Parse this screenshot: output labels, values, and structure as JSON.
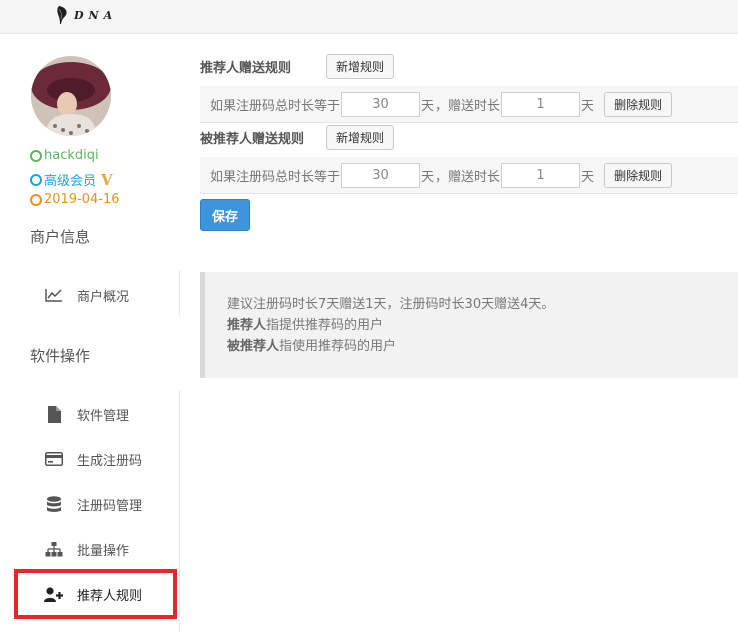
{
  "brand": {
    "logo_text": "DNA"
  },
  "user": {
    "username": "hackdiqi",
    "member_level": "高级会员",
    "vip_badge": "V",
    "join_date": "2019-04-16",
    "colors": {
      "username": "#5cb85c",
      "member_level": "#1fa3e0",
      "join_date": "#f0901e",
      "vip_badge": "#f3a53b"
    }
  },
  "sidebar": {
    "merchant_section": "商户信息",
    "merchant_items": [
      {
        "label": "商户概况",
        "icon": "line-chart-icon"
      }
    ],
    "software_section": "软件操作",
    "software_items": [
      {
        "label": "软件管理",
        "icon": "file-icon"
      },
      {
        "label": "生成注册码",
        "icon": "credit-card-icon"
      },
      {
        "label": "注册码管理",
        "icon": "database-icon"
      },
      {
        "label": "批量操作",
        "icon": "sitemap-icon"
      },
      {
        "label": "推荐人规则",
        "icon": "user-plus-icon",
        "active": true
      }
    ],
    "active_highlight_color": "#e8262c"
  },
  "referrer_rules": {
    "title": "推荐人赠送规则",
    "add_button": "新增规则",
    "rows": [
      {
        "prefix": "如果注册码总时长等于",
        "duration": "30",
        "duration_unit": "天",
        "middle": "，赠送时长",
        "bonus": "1",
        "bonus_unit": "天",
        "delete_button": "删除规则"
      }
    ]
  },
  "referee_rules": {
    "title": "被推荐人赠送规则",
    "add_button": "新增规则",
    "rows": [
      {
        "prefix": "如果注册码总时长等于",
        "duration": "30",
        "duration_unit": "天",
        "middle": "，赠送时长",
        "bonus": "1",
        "bonus_unit": "天",
        "delete_button": "删除规则"
      }
    ]
  },
  "save_button": "保存",
  "notice": {
    "line1": "建议注册码时长7天赠送1天，注册码时长30天赠送4天。",
    "line2_bold": "推荐人",
    "line2_rest": "指提供推荐码的用户",
    "line3_bold": "被推荐人",
    "line3_rest": "指使用推荐码的用户"
  },
  "theme": {
    "primary": "#3d95de"
  }
}
